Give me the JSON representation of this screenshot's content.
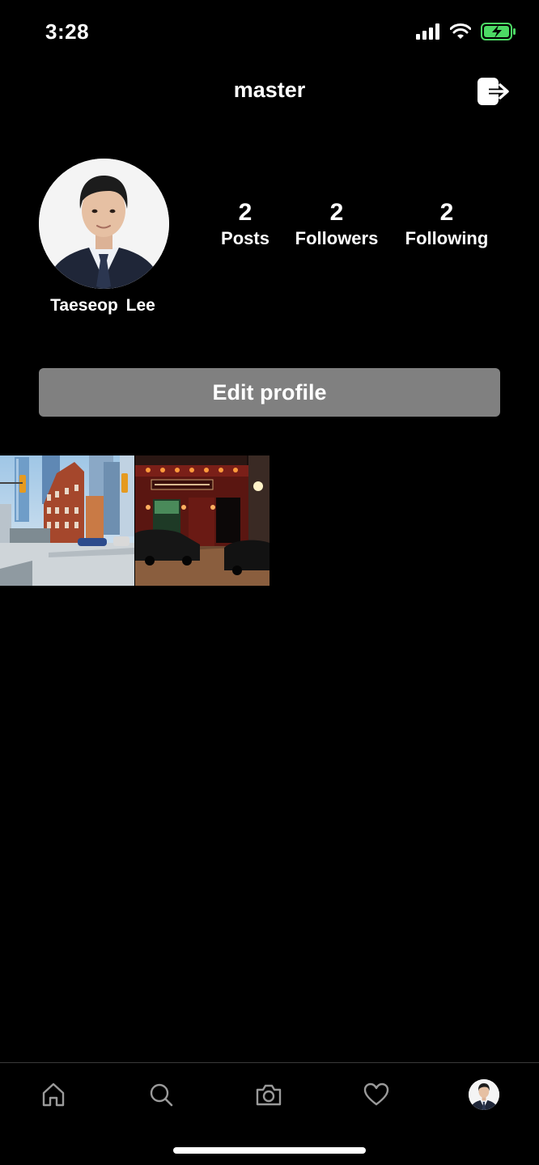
{
  "status_bar": {
    "time": "3:28"
  },
  "header": {
    "username": "master"
  },
  "profile": {
    "display_name": "Taeseop  Lee",
    "stats": [
      {
        "value": "2",
        "label": "Posts"
      },
      {
        "value": "2",
        "label": "Followers"
      },
      {
        "value": "2",
        "label": "Following"
      }
    ],
    "edit_button_label": "Edit profile"
  },
  "posts": [
    {
      "name": "city-street-photo"
    },
    {
      "name": "restaurant-night-photo"
    }
  ],
  "tab_bar": {
    "items": [
      "home-icon",
      "search-icon",
      "camera-icon",
      "heart-icon",
      "profile-avatar"
    ]
  },
  "colors": {
    "background": "#000000",
    "button_gray": "#808080",
    "battery_green": "#4cd964"
  }
}
